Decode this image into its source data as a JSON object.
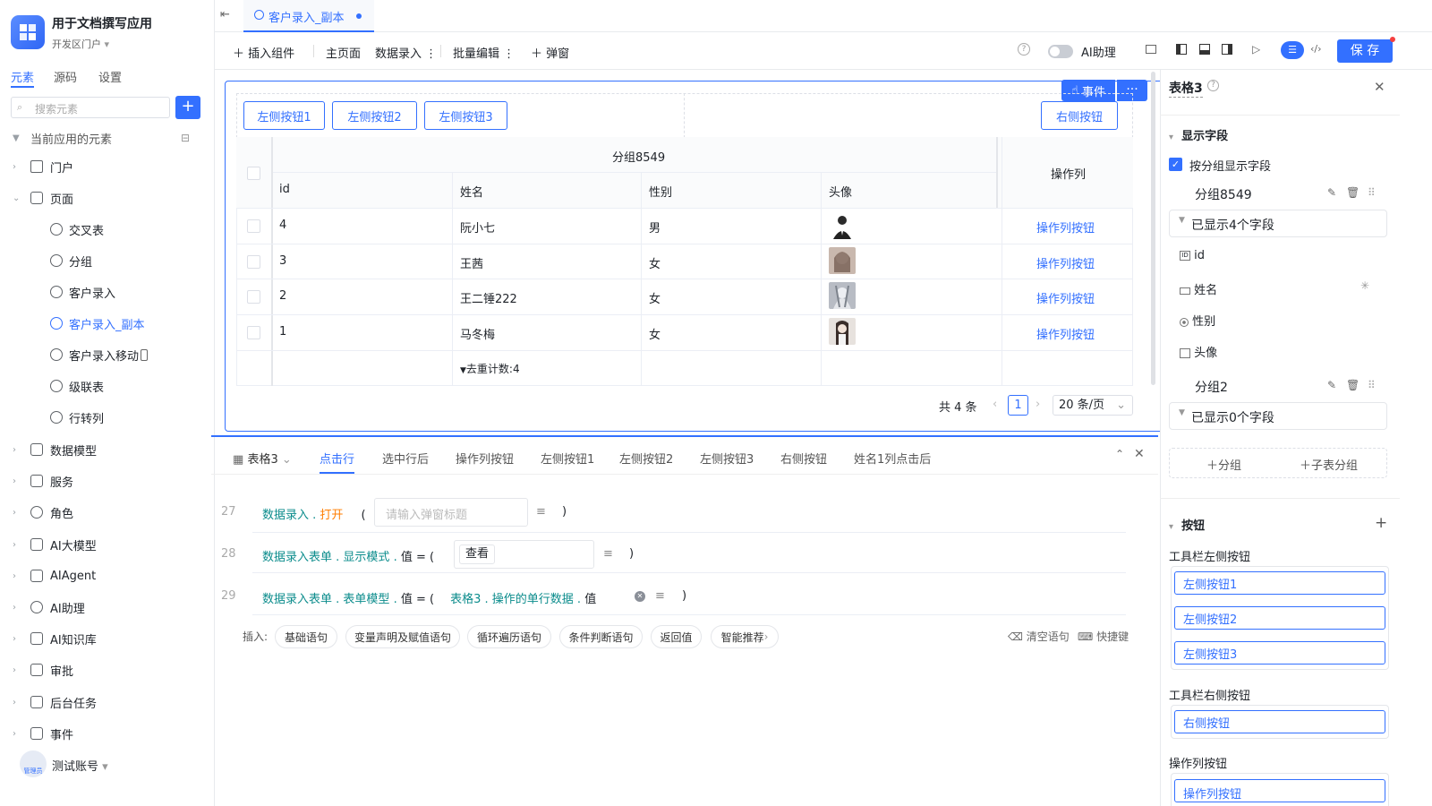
{
  "app": {
    "title": "用于文档撰写应用",
    "env": "开发区门户"
  },
  "left_tabs": [
    "元素",
    "源码",
    "设置"
  ],
  "search": {
    "placeholder": "搜索元素"
  },
  "tree": {
    "section": "当前应用的元素",
    "items": [
      "门户",
      "页面"
    ],
    "pages": [
      "交叉表",
      "分组",
      "客户录入",
      "客户录入_副本",
      "客户录入移动",
      "级联表",
      "行转列"
    ],
    "others": [
      "数据模型",
      "服务",
      "角色",
      "AI大模型",
      "AIAgent",
      "AI助理",
      "AI知识库",
      "审批",
      "后台任务",
      "事件"
    ]
  },
  "account": {
    "name": "测试账号",
    "badge": "管理员"
  },
  "tab": {
    "title": "客户录入_副本"
  },
  "toolbar": {
    "insert": "插入组件",
    "main": "主页面",
    "data_entry": "数据录入",
    "batch": "批量编辑",
    "popup": "弹窗",
    "ai": "AI助理",
    "save": "保 存"
  },
  "canvas": {
    "event_label": "事件",
    "left_buttons": [
      "左侧按钮1",
      "左侧按钮2",
      "左侧按钮3"
    ],
    "right_button": "右侧按钮",
    "group_header": "分组8549",
    "columns": [
      "id",
      "姓名",
      "性别",
      "头像"
    ],
    "action_header": "操作列",
    "rows": [
      {
        "id": "4",
        "name": "阮小七",
        "gender": "男",
        "action": "操作列按钮"
      },
      {
        "id": "3",
        "name": "王茜",
        "gender": "女",
        "action": "操作列按钮"
      },
      {
        "id": "2",
        "name": "王二锤222",
        "gender": "女",
        "action": "操作列按钮"
      },
      {
        "id": "1",
        "name": "马冬梅",
        "gender": "女",
        "action": "操作列按钮"
      }
    ],
    "summary": "去重计数:4",
    "total": "共 4 条",
    "page": "1",
    "page_size": "20 条/页"
  },
  "bottom": {
    "component": "表格3",
    "tabs": [
      "点击行",
      "选中行后",
      "操作列按钮",
      "左侧按钮1",
      "左侧按钮2",
      "左侧按钮3",
      "右侧按钮",
      "姓名1列点击后"
    ],
    "lines": [
      {
        "no": "27",
        "obj": "数据录入",
        "method": "打开",
        "placeholder": "请输入弹窗标题"
      },
      {
        "no": "28",
        "obj": "数据录入表单",
        "prop": "显示模式",
        "val": "值",
        "tag": "查看"
      },
      {
        "no": "29",
        "obj": "数据录入表单",
        "prop": "表单模型",
        "val": "值",
        "rhs_obj": "表格3",
        "rhs_prop": "操作的单行数据",
        "rhs_val": "值"
      }
    ],
    "insert_label": "插入:",
    "chips": [
      "基础语句",
      "变量声明及赋值语句",
      "循环遍历语句",
      "条件判断语句",
      "返回值",
      "智能推荐"
    ],
    "clear": "清空语句",
    "shortcut": "快捷键"
  },
  "right": {
    "title": "表格3",
    "display_section": "显示字段",
    "by_group": "按分组显示字段",
    "group1": "分组8549",
    "shown1": "已显示4个字段",
    "fields": [
      "id",
      "姓名",
      "性别",
      "头像"
    ],
    "group2": "分组2",
    "shown2": "已显示0个字段",
    "add_group": "分组",
    "add_sub_group": "子表分组",
    "btn_section": "按钮",
    "left_bar": "工具栏左侧按钮",
    "left_buttons": [
      "左侧按钮1",
      "左侧按钮2",
      "左侧按钮3"
    ],
    "right_bar": "工具栏右侧按钮",
    "right_buttons": [
      "右侧按钮"
    ],
    "action_section": "操作列按钮",
    "action_buttons": [
      "操作列按钮"
    ]
  },
  "colors": {
    "primary": "#3370ff",
    "code": "#0b8c8c",
    "accent": "#ff7d00"
  }
}
